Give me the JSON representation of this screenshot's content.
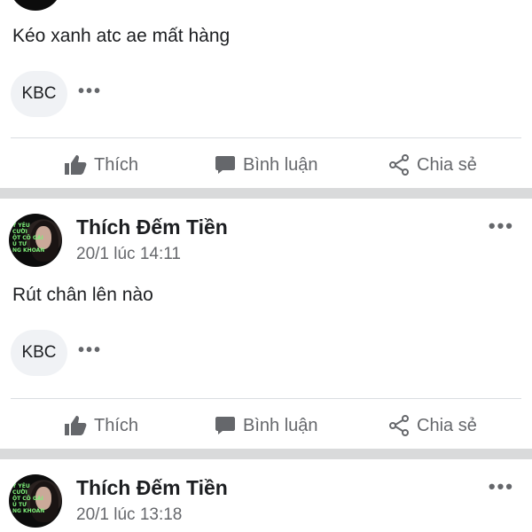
{
  "posts": [
    {
      "text": "Kéo xanh atc ae mất hàng",
      "group_chip": "KBC",
      "chip_more": "•••"
    },
    {
      "author": "Thích Đếm Tiền",
      "timestamp": "20/1 lúc 14:11",
      "text": "Rút chân lên nào",
      "group_chip": "KBC",
      "chip_more": "•••",
      "more": "•••"
    },
    {
      "author": "Thích Đếm Tiền",
      "timestamp": "20/1 lúc 13:18",
      "more": "•••"
    }
  ],
  "actions": {
    "like": "Thích",
    "comment": "Bình luận",
    "share": "Chia sẻ"
  },
  "avatar_text": [
    "Y YÊU",
    "CƯỜI",
    "ỘT CÔ GÁI",
    "U TƯ",
    "NG KHOÁN"
  ],
  "colors": {
    "icon_gray": "#65676b",
    "separator": "#d9dadb",
    "chip_bg": "#f0f2f5"
  }
}
